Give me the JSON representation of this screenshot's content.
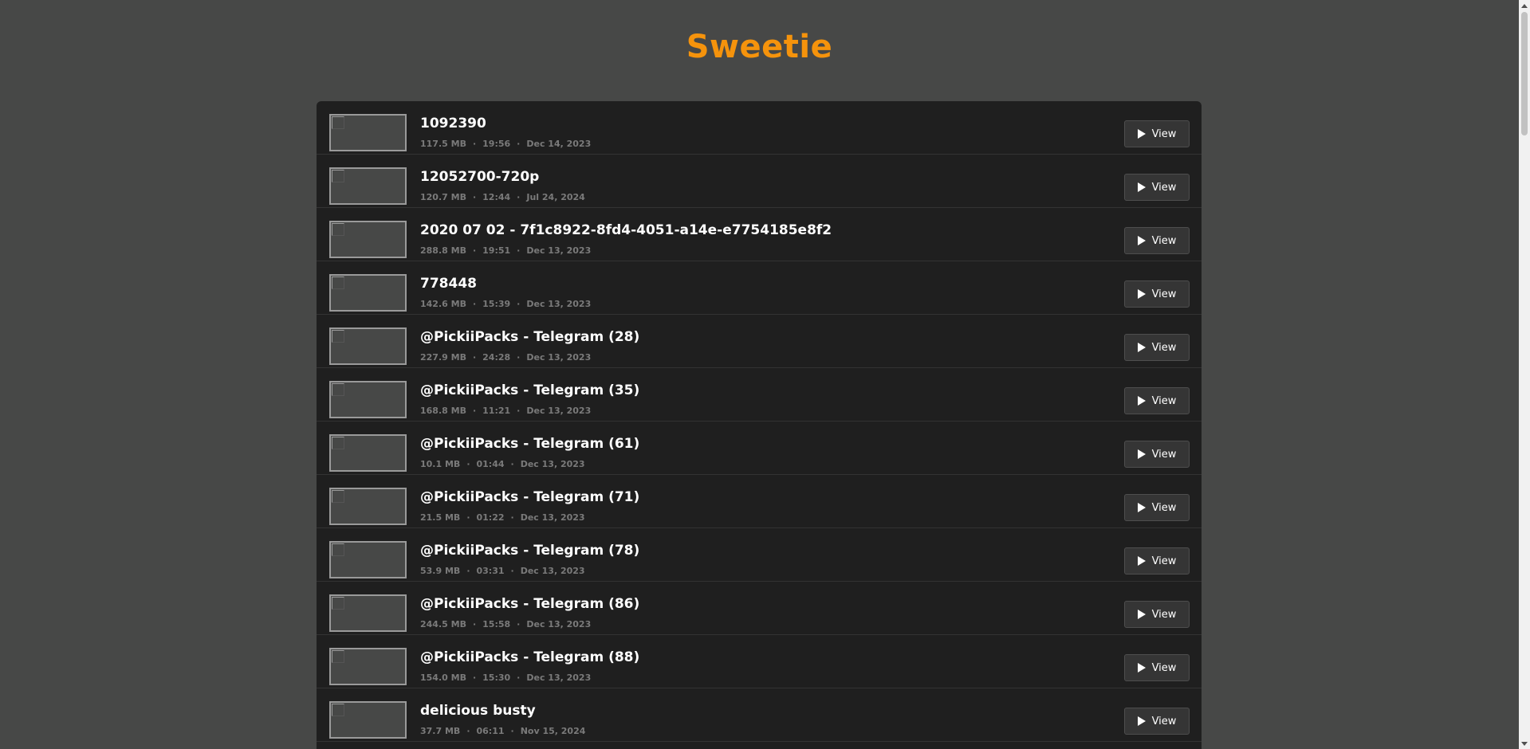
{
  "site": {
    "title": "Sweetie",
    "accent_color": "#f5930c"
  },
  "view_label": "View",
  "videos": [
    {
      "name": "1092390",
      "size": "117.5 MB",
      "duration": "19:56",
      "date": "Dec 14, 2023"
    },
    {
      "name": "12052700-720p",
      "size": "120.7 MB",
      "duration": "12:44",
      "date": "Jul 24, 2024"
    },
    {
      "name": "2020 07 02 - 7f1c8922-8fd4-4051-a14e-e7754185e8f2",
      "size": "288.8 MB",
      "duration": "19:51",
      "date": "Dec 13, 2023"
    },
    {
      "name": "778448",
      "size": "142.6 MB",
      "duration": "15:39",
      "date": "Dec 13, 2023"
    },
    {
      "name": "@PickiiPacks - Telegram (28)",
      "size": "227.9 MB",
      "duration": "24:28",
      "date": "Dec 13, 2023"
    },
    {
      "name": "@PickiiPacks - Telegram (35)",
      "size": "168.8 MB",
      "duration": "11:21",
      "date": "Dec 13, 2023"
    },
    {
      "name": "@PickiiPacks - Telegram (61)",
      "size": "10.1 MB",
      "duration": "01:44",
      "date": "Dec 13, 2023"
    },
    {
      "name": "@PickiiPacks - Telegram (71)",
      "size": "21.5 MB",
      "duration": "01:22",
      "date": "Dec 13, 2023"
    },
    {
      "name": "@PickiiPacks - Telegram (78)",
      "size": "53.9 MB",
      "duration": "03:31",
      "date": "Dec 13, 2023"
    },
    {
      "name": "@PickiiPacks - Telegram (86)",
      "size": "244.5 MB",
      "duration": "15:58",
      "date": "Dec 13, 2023"
    },
    {
      "name": "@PickiiPacks - Telegram (88)",
      "size": "154.0 MB",
      "duration": "15:30",
      "date": "Dec 13, 2023"
    },
    {
      "name": "delicious busty",
      "size": "37.7 MB",
      "duration": "06:11",
      "date": "Nov 15, 2024"
    }
  ]
}
